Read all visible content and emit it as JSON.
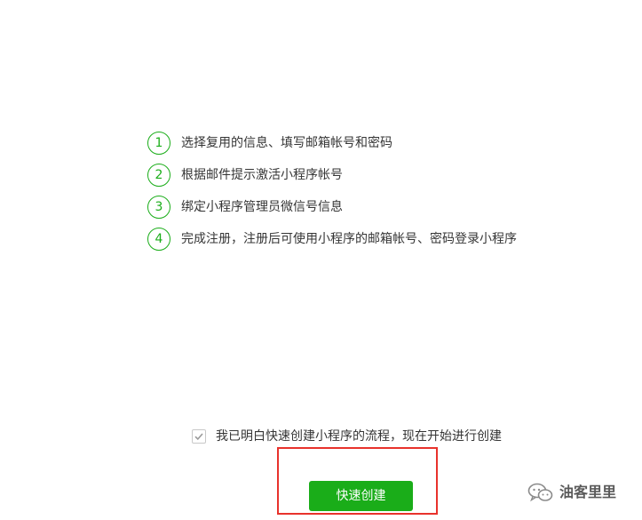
{
  "steps": [
    {
      "number": "1",
      "text": "选择复用的信息、填写邮箱帐号和密码"
    },
    {
      "number": "2",
      "text": "根据邮件提示激活小程序帐号"
    },
    {
      "number": "3",
      "text": "绑定小程序管理员微信号信息"
    },
    {
      "number": "4",
      "text": "完成注册，注册后可使用小程序的邮箱帐号、密码登录小程序"
    }
  ],
  "agreement": {
    "checked": true,
    "text": "我已明白快速创建小程序的流程，现在开始进行创建"
  },
  "primary_button": {
    "label": "快速创建"
  },
  "watermark": {
    "text": "油客里里",
    "icon": "wechat-icon"
  },
  "colors": {
    "brand_green": "#1aad19",
    "highlight_red": "#e8322c",
    "text": "#353535"
  }
}
